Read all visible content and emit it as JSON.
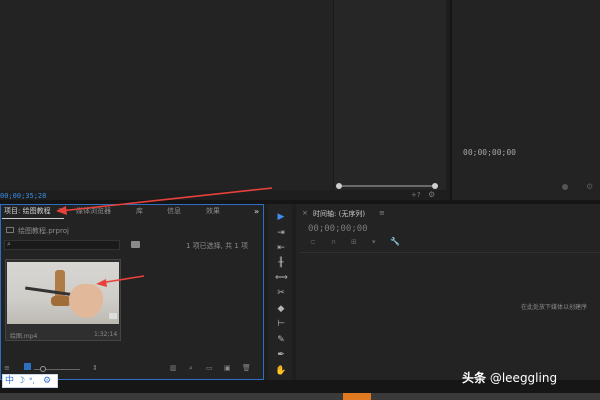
{
  "source_monitor": {
    "timecode": "00;00;35;28"
  },
  "program_monitor": {
    "timecode": "00;00;00;00"
  },
  "project_panel": {
    "tabs": [
      "项目: 绘图教程",
      "媒体浏览器",
      "库",
      "信息",
      "效果"
    ],
    "tab_menu_glyph": "≡",
    "more_glyph": "»",
    "filename": "绘图教程.prproj",
    "search_placeholder": "",
    "selection_status": "1 项已选择, 共 1 项",
    "clip": {
      "name": "绘图.mp4",
      "duration": "1;32;14"
    }
  },
  "timeline": {
    "title": "时间轴: (无序列)",
    "timecode": "00;00;00;00",
    "drop_hint": "在此处放下媒体以创建序",
    "menu_glyph": "≡",
    "close_glyph": "×"
  },
  "ime_toolbar": {
    "mode": "中",
    "moon": "☽",
    "punct": "°,",
    "gear": "⚙"
  },
  "watermark": {
    "brand": "头条",
    "handle": "@leeggling"
  },
  "colors": {
    "accent_blue": "#2d6fc0",
    "annotation_red": "#e8413a",
    "status_orange": "#e07a20"
  },
  "icons": [
    "search-icon",
    "bin-icon",
    "selection-tool-icon",
    "track-select-icon",
    "ripple-edit-icon",
    "rolling-edit-icon",
    "rate-stretch-icon",
    "razor-icon",
    "slip-icon",
    "slide-icon",
    "pen-icon",
    "hand-icon",
    "wrench-icon"
  ]
}
